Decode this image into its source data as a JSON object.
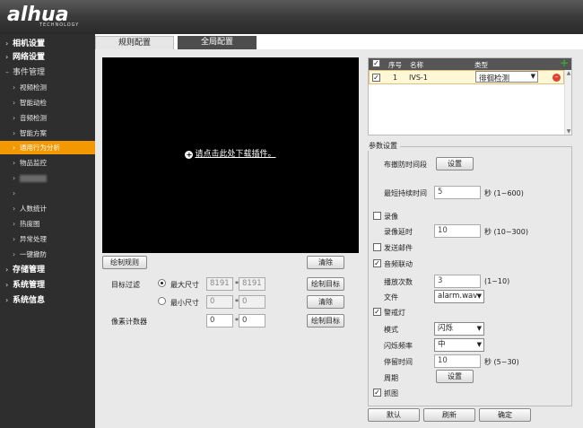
{
  "brand": {
    "logo": "alhua",
    "subtitle": "TECHNOLOGY"
  },
  "sidebar": {
    "items": [
      {
        "label": "相机设置",
        "type": "top"
      },
      {
        "label": "网络设置",
        "type": "top"
      },
      {
        "label": "事件管理",
        "type": "top-dim"
      },
      {
        "label": "视频检测",
        "type": "sub"
      },
      {
        "label": "智能动检",
        "type": "sub"
      },
      {
        "label": "音频检测",
        "type": "sub"
      },
      {
        "label": "智能方案",
        "type": "sub"
      },
      {
        "label": "通用行为分析",
        "type": "sub",
        "active": true
      },
      {
        "label": "物品监控",
        "type": "sub"
      },
      {
        "label": "",
        "type": "sub-blur"
      },
      {
        "label": "",
        "type": "sub"
      },
      {
        "label": "人数统计",
        "type": "sub"
      },
      {
        "label": "热度图",
        "type": "sub"
      },
      {
        "label": "异常处理",
        "type": "sub"
      },
      {
        "label": "一键撤防",
        "type": "sub"
      },
      {
        "label": "存储管理",
        "type": "top"
      },
      {
        "label": "系统管理",
        "type": "top"
      },
      {
        "label": "系统信息",
        "type": "top"
      }
    ]
  },
  "tabs": {
    "active": "规则配置",
    "inactive": "全局配置"
  },
  "video": {
    "link_text": "请点击此处下载插件。"
  },
  "left": {
    "draw_rule": "绘制规则",
    "clear": "清除",
    "target_filter": "目标过滤",
    "max_size": "最大尺寸",
    "min_size": "最小尺寸",
    "max_w": "8191",
    "max_h": "8191",
    "min_w": "0",
    "min_h": "0",
    "draw_target": "绘制目标",
    "clear2": "清除",
    "pixel_counter": "像素计数器",
    "pix_w": "0",
    "pix_h": "0",
    "draw_target2": "绘制目标",
    "times": "*"
  },
  "table": {
    "headers": {
      "no": "序号",
      "name": "名称",
      "type": "类型"
    },
    "row": {
      "no": "1",
      "name": "IVS-1",
      "type": "徘徊检测"
    }
  },
  "params": {
    "title": "参数设置",
    "schedule": "布撤防时间段",
    "setup": "设置",
    "min_duration": "最短持续时间",
    "min_duration_val": "5",
    "min_duration_unit": "秒 (1~600)",
    "record": "录像",
    "record_delay": "录像延时",
    "record_delay_val": "10",
    "record_delay_unit": "秒 (10~300)",
    "send_email": "发送邮件",
    "audio_link": "音频联动",
    "play_count": "播放次数",
    "play_count_val": "3",
    "play_count_unit": "(1~10)",
    "file": "文件",
    "file_val": "alarm.wav",
    "warning_light": "警戒灯",
    "mode": "模式",
    "mode_val": "闪烁",
    "flash_freq": "闪烁频率",
    "flash_freq_val": "中",
    "stay_time": "停留时间",
    "stay_time_val": "10",
    "stay_time_unit": "秒 (5~30)",
    "period": "周期",
    "period_setup": "设置",
    "snapshot": "抓图"
  },
  "footer": {
    "default": "默认",
    "refresh": "刷新",
    "ok": "确定"
  }
}
